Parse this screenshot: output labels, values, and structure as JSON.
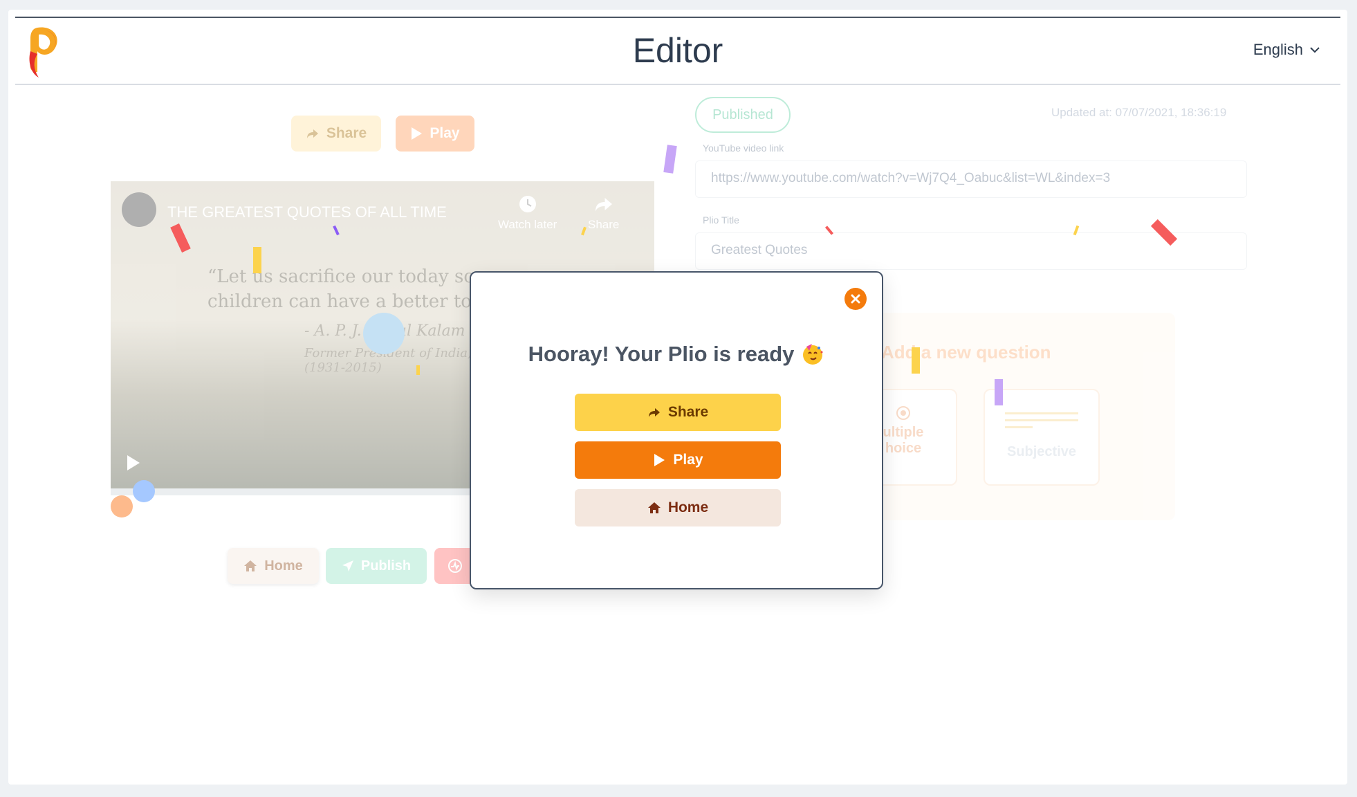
{
  "header": {
    "title": "Editor",
    "language": "English"
  },
  "player_toolbar": {
    "share_label": "Share",
    "play_label": "Play"
  },
  "video": {
    "title": "THE GREATEST QUOTES OF ALL TIME",
    "watch_later_label": "Watch later",
    "share_label": "Share",
    "quote_line1": "“Let us sacrifice our today so",
    "quote_line2": "children can have a better to",
    "quote_author": "- A. P. J. Abdul Kalam",
    "quote_sub": "Former President of India,",
    "quote_years": "(1931-2015)"
  },
  "bottom_actions": {
    "home_label": "Home",
    "publish_label": "Publish"
  },
  "details": {
    "status_badge": "Published",
    "updated_at": "Updated at: 07/07/2021, 18:36:19",
    "video_link_label": "YouTube video link",
    "video_link_value": "https://www.youtube.com/watch?v=Wj7Q4_Oabuc&list=WL&index=3",
    "title_label": "Plio Title",
    "title_value": "Greatest Quotes"
  },
  "questions": {
    "add_label": "Add a new question",
    "mc_label_line1": "ultiple",
    "mc_label_line2": "hoice",
    "subjective_label": "Subjective"
  },
  "modal": {
    "heading": "Hooray! Your Plio is ready",
    "share_label": "Share",
    "play_label": "Play",
    "home_label": "Home"
  },
  "colors": {
    "accent_orange": "#f47b0c",
    "share_yellow": "#fdd24a",
    "home_beige": "#f4e7de",
    "published_green": "#5fd0a3"
  }
}
